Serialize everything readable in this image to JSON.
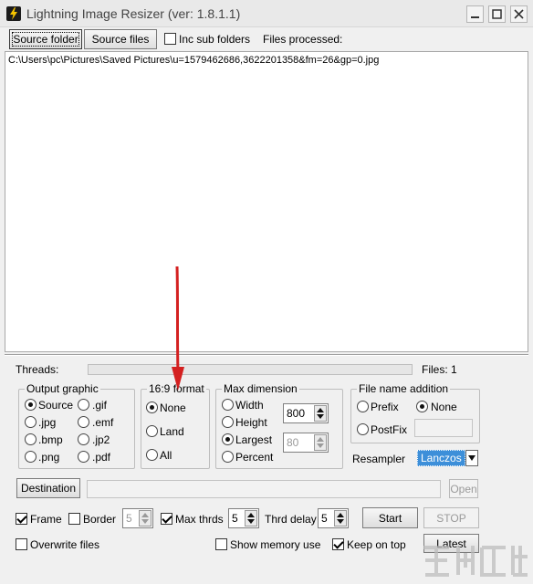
{
  "window": {
    "title": "Lightning Image Resizer (ver: 1.8.1.1)"
  },
  "toolbar": {
    "source_folder": "Source folder",
    "source_files": "Source files",
    "inc_sub_folders": "Inc sub folders",
    "inc_sub_folders_checked": false,
    "files_processed": "Files processed:"
  },
  "file_list": [
    "C:\\Users\\pc\\Pictures\\Saved Pictures\\u=1579462686,3622201358&fm=26&gp=0.jpg"
  ],
  "status": {
    "threads_label": "Threads:",
    "files_label": "Files: 1"
  },
  "output_graphic": {
    "title": "Output graphic",
    "options": [
      {
        "label": "Source",
        "checked": true
      },
      {
        "label": ".gif",
        "checked": false
      },
      {
        "label": ".jpg",
        "checked": false
      },
      {
        "label": ".emf",
        "checked": false
      },
      {
        "label": ".bmp",
        "checked": false
      },
      {
        "label": ".jp2",
        "checked": false
      },
      {
        "label": ".png",
        "checked": false
      },
      {
        "label": ".pdf",
        "checked": false
      }
    ]
  },
  "format_169": {
    "title": "16:9 format",
    "options": [
      {
        "label": "None",
        "checked": true
      },
      {
        "label": "Land",
        "checked": false
      },
      {
        "label": "All",
        "checked": false
      }
    ]
  },
  "max_dimension": {
    "title": "Max dimension",
    "options": [
      {
        "label": "Width",
        "checked": false
      },
      {
        "label": "Height",
        "checked": false
      },
      {
        "label": "Largest",
        "checked": true
      },
      {
        "label": "Percent",
        "checked": false
      }
    ],
    "size_value": "800",
    "percent_value": "80"
  },
  "file_name_addition": {
    "title": "File name addition",
    "prefix": "Prefix",
    "none": "None",
    "postfix": "PostFix",
    "selected": "None"
  },
  "resampler": {
    "label": "Resampler",
    "value": "Lanczos"
  },
  "destination": {
    "button": "Destination",
    "open": "Open"
  },
  "options_row": {
    "frame": "Frame",
    "frame_checked": true,
    "border": "Border",
    "border_checked": false,
    "border_value": "5",
    "max_thrds": "Max thrds",
    "max_thrds_checked": true,
    "max_thrds_value": "5",
    "thrd_delay": "Thrd delay",
    "thrd_delay_value": "5",
    "start": "Start",
    "stop": "STOP"
  },
  "bottom_row": {
    "overwrite": "Overwrite files",
    "overwrite_checked": false,
    "show_memory": "Show memory use",
    "show_memory_checked": false,
    "keep_on_top": "Keep on top",
    "keep_on_top_checked": true,
    "latest": "Latest"
  },
  "colors": {
    "annotation_arrow": "#d42020",
    "selection": "#3d8fd9"
  },
  "icons": {
    "app": "lightning-icon",
    "minimize": "minimize-icon",
    "maximize": "maximize-icon",
    "close": "close-icon"
  }
}
